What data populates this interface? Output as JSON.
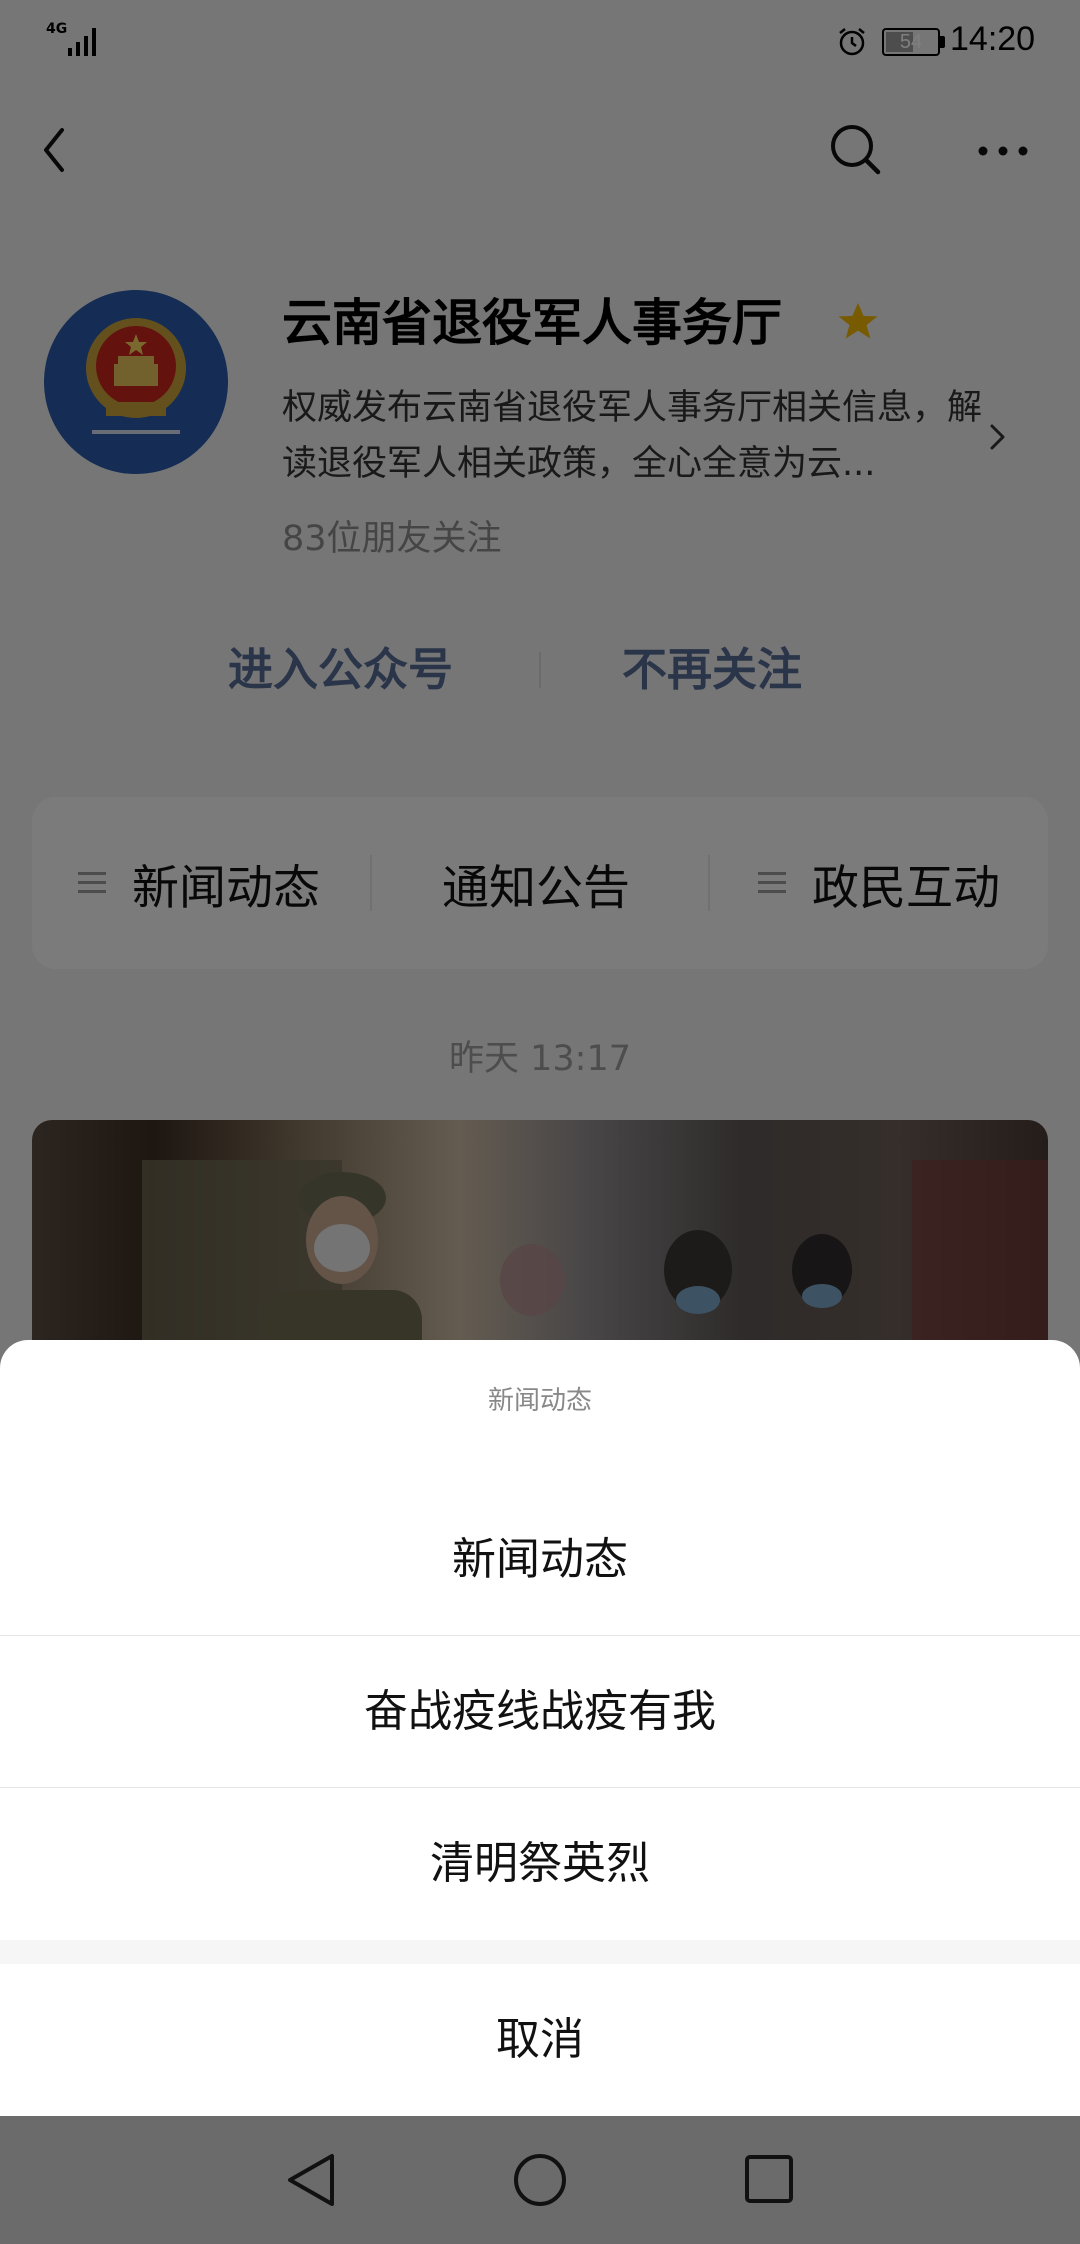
{
  "status_bar": {
    "network": "4G",
    "battery": "54",
    "battery_level": 0.54,
    "time": "14:20"
  },
  "account": {
    "name": "云南省退役军人事务厅",
    "description": "权威发布云南省退役军人事务厅相关信息，解读退役军人相关政策，全心全意为云...",
    "followers": "83位朋友关注",
    "actions": {
      "enter": "进入公众号",
      "unfollow": "不再关注"
    }
  },
  "menu": {
    "items": [
      "新闻动态",
      "通知公告",
      "政民互动"
    ]
  },
  "feed": {
    "timestamp": "昨天 13:17"
  },
  "sheet": {
    "title": "新闻动态",
    "options": [
      "新闻动态",
      "奋战疫线战疫有我",
      "清明祭英烈"
    ],
    "cancel": "取消"
  },
  "colors": {
    "link_blue": "#576b95",
    "star_gold": "#f0b400",
    "emblem_blue": "#2a5aa8",
    "mask": "rgba(0,0,0,0.5)"
  },
  "icons": {
    "back": "back-arrow-icon",
    "search": "search-icon",
    "more": "more-dots-icon",
    "star": "star-icon",
    "menu": "menu-lines-icon"
  }
}
